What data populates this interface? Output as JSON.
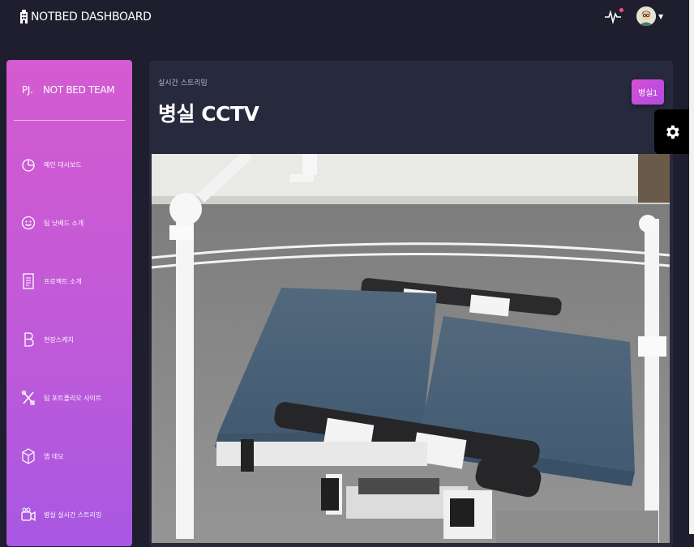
{
  "header": {
    "brand": "NOTBED DASHBOARD"
  },
  "sidebar": {
    "team_prefix": "PJ.",
    "team_name": "NOT BED TEAM",
    "items": [
      {
        "icon": "chart-pie-icon",
        "label": "메인 대시보드"
      },
      {
        "icon": "smile-icon",
        "label": "팀 낫베드 소개"
      },
      {
        "icon": "document-icon",
        "label": "프로젝트 소개"
      },
      {
        "icon": "bootstrap-b-icon",
        "label": "현장스케치"
      },
      {
        "icon": "tools-icon",
        "label": "팀 포트폴리오 사이트"
      },
      {
        "icon": "box-icon",
        "label": "앱 데모"
      },
      {
        "icon": "camera-icon",
        "label": "병실 실시간 스트리밍"
      }
    ]
  },
  "main": {
    "subtitle": "실시간 스트리밍",
    "title": "병실 CCTV",
    "room_button": "병실1"
  },
  "colors": {
    "background": "#1e1e2e",
    "panel": "#27293d",
    "sidebar_gradient_top": "#d45bd0",
    "sidebar_gradient_bottom": "#a858e2",
    "notification_dot": "#ff4b7d"
  }
}
